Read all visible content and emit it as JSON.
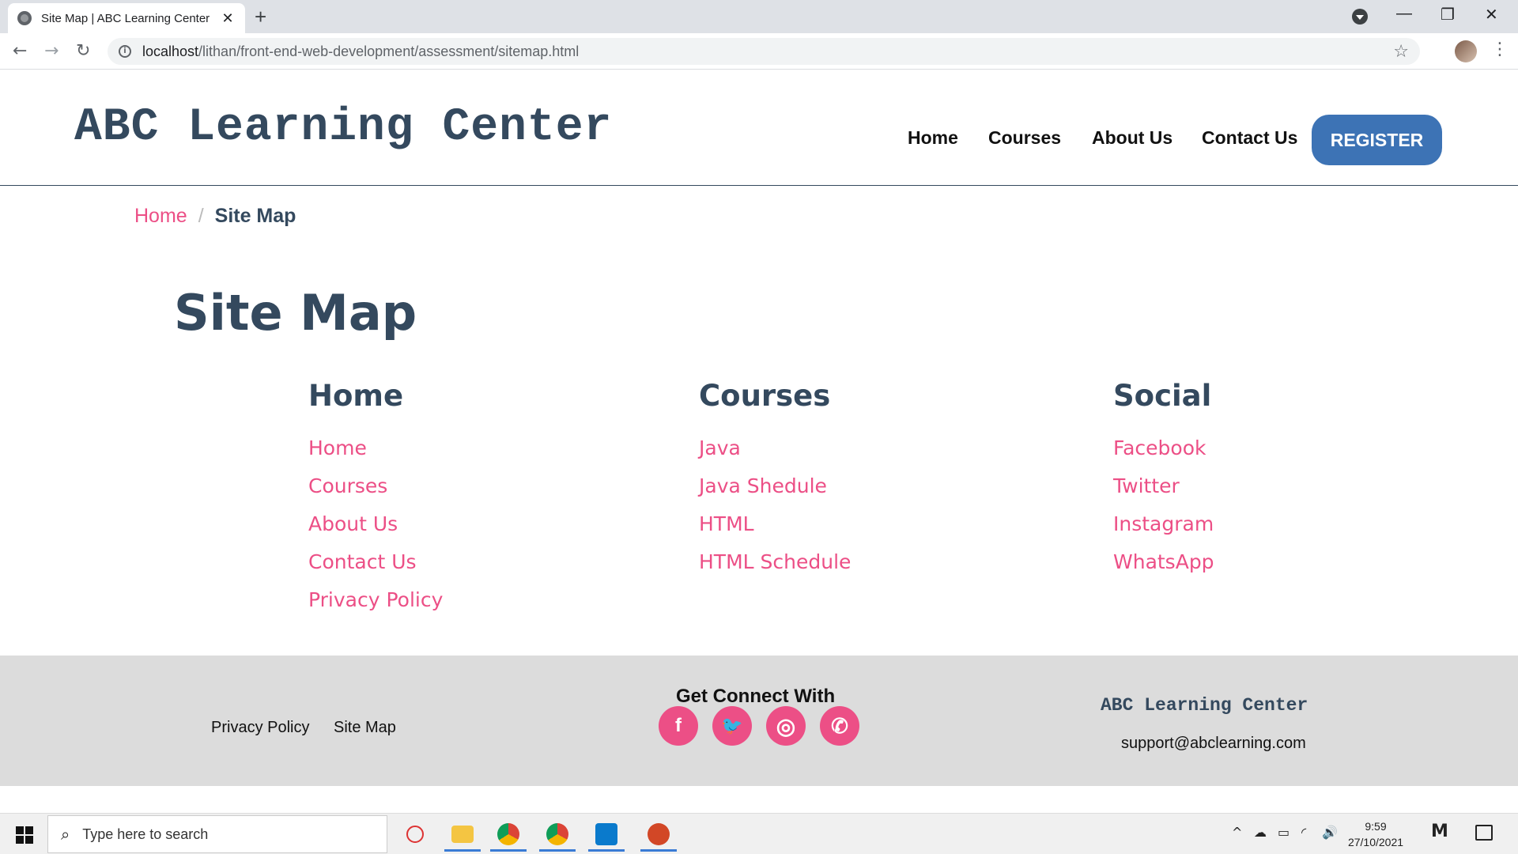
{
  "browser": {
    "tab_title": "Site Map | ABC Learning Center",
    "tab_close": "✕",
    "new_tab": "+",
    "url_host": "localhost",
    "url_path": "/lithan/front-end-web-development/assessment/sitemap.html",
    "back": "←",
    "forward": "→",
    "reload": "↻",
    "star": "☆",
    "menu": "⋮",
    "minimize": "—",
    "maximize": "❐",
    "close": "✕"
  },
  "header": {
    "brand": "ABC Learning Center",
    "nav": [
      "Home",
      "Courses",
      "About Us",
      "Contact Us"
    ],
    "register": "REGISTER"
  },
  "breadcrumb": {
    "home": "Home",
    "separator": "/",
    "current": "Site Map"
  },
  "main": {
    "title": "Site Map",
    "columns": [
      {
        "title": "Home",
        "links": [
          "Home",
          "Courses",
          "About Us",
          "Contact Us",
          "Privacy Policy"
        ]
      },
      {
        "title": "Courses",
        "links": [
          "Java",
          "Java Shedule",
          "HTML",
          "HTML Schedule"
        ]
      },
      {
        "title": "Social",
        "links": [
          "Facebook",
          "Twitter",
          "Instagram",
          "WhatsApp"
        ]
      }
    ]
  },
  "footer": {
    "links": [
      "Privacy Policy",
      "Site Map"
    ],
    "connect_title": "Get Connect With",
    "social_icons": [
      {
        "name": "facebook-icon",
        "glyph": "f"
      },
      {
        "name": "twitter-icon",
        "glyph": "🐦"
      },
      {
        "name": "instagram-icon",
        "glyph": "◎"
      },
      {
        "name": "whatsapp-icon",
        "glyph": "✆"
      }
    ],
    "brand": "ABC Learning Center",
    "email": "support@abclearning.com"
  },
  "taskbar": {
    "search_placeholder": "Type here to search",
    "time": "9:59",
    "date": "27/10/2021",
    "tray_chevron": "^",
    "tray_cloud": "☁",
    "tray_battery": "▭",
    "tray_wifi": "◜",
    "tray_volume": "🔊",
    "tray_ime": "M"
  },
  "colors": {
    "brand": "#34495e",
    "accent": "#ec4f86",
    "register": "#3d73b5",
    "footer_bg": "#dcdcdc"
  }
}
